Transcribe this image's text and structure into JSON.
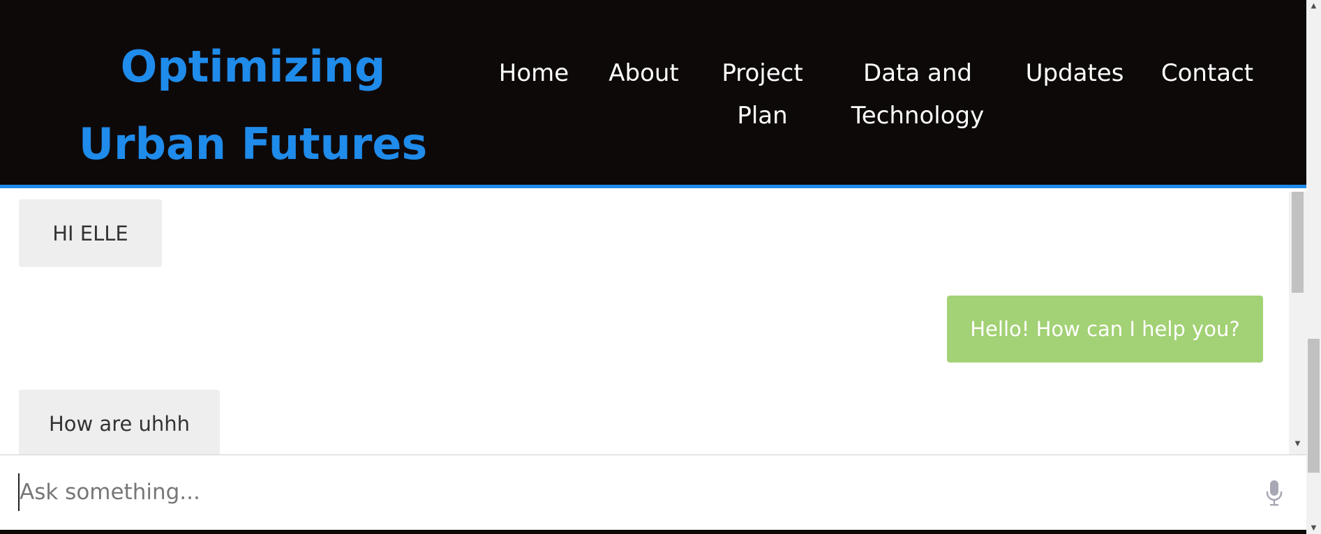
{
  "header": {
    "brand": "Optimizing Urban Futures",
    "nav": [
      {
        "label": "Home"
      },
      {
        "label": "About"
      },
      {
        "label": "Project Plan"
      },
      {
        "label": "Data and Technology"
      },
      {
        "label": "Updates"
      },
      {
        "label": "Contact"
      }
    ]
  },
  "chat": {
    "messages": [
      {
        "role": "user",
        "text": "HI ELLE"
      },
      {
        "role": "bot",
        "text": "Hello! How can I help you?"
      },
      {
        "role": "user",
        "text": "How are uhhh"
      }
    ]
  },
  "input": {
    "placeholder": "Ask something...",
    "value": ""
  },
  "colors": {
    "header_bg": "#0e0909",
    "brand": "#1f8bea",
    "accent_border": "#1f8bea",
    "user_bubble": "#eeeeee",
    "bot_bubble": "#a3d175"
  },
  "icons": {
    "mic": "microphone-icon"
  }
}
